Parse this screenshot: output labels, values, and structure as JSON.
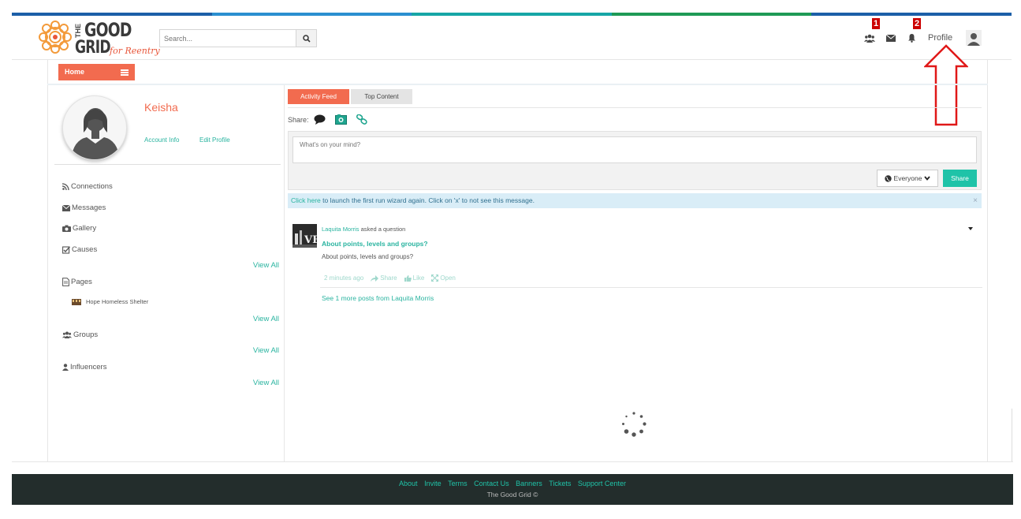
{
  "brand": {
    "the": "THE",
    "good": "GOOD",
    "grid": "GRID",
    "tagline": "for Reentry",
    "colors": {
      "accent": "#f26b4f",
      "teal": "#1fc3a8",
      "link": "#2ab4a0",
      "footer_bg": "#232d2c",
      "badge": "#cc0000"
    }
  },
  "search": {
    "placeholder": "Search...",
    "icon": "search-icon"
  },
  "header": {
    "friend_requests_badge": "1",
    "notifications_badge": "2",
    "profile_label": "Profile",
    "icons": [
      "users-icon",
      "envelope-icon",
      "bell-icon",
      "user-avatar-icon"
    ]
  },
  "nav": {
    "home_label": "Home",
    "menu_icon": "bars-icon"
  },
  "user": {
    "name": "Keisha",
    "account_info": "Account Info",
    "edit_profile": "Edit Profile"
  },
  "sidebar": {
    "connections": "Connections",
    "messages": "Messages",
    "gallery": "Gallery",
    "causes": "Causes",
    "pages": "Pages",
    "page_item": "Hope Homeless Shelter",
    "groups": "Groups",
    "influencers": "Influencers",
    "view_all": "View All"
  },
  "feed": {
    "tabs": [
      "Activity Feed",
      "Top Content"
    ],
    "share_label": "Share:",
    "composer_placeholder": "What's on your mind?",
    "audience": "Everyone",
    "share_button": "Share",
    "notice_link": "Click here",
    "notice_text": " to launch the first run wizard again. Click on 'x' to not see this message.",
    "notice_close": "×",
    "post": {
      "author": "Laquita Morris",
      "action": " asked a question",
      "title": "About points, levels and groups?",
      "body": "About points, levels and groups?",
      "time": "2 minutes ago",
      "share": "Share",
      "like": "Like",
      "open": "Open"
    },
    "see_more": "See 1 more posts from Laquita Morris"
  },
  "footer": {
    "links": [
      "About",
      "Invite",
      "Terms",
      "Contact Us",
      "Banners",
      "Tickets",
      "Support Center"
    ],
    "copyright": "The Good Grid ©"
  }
}
